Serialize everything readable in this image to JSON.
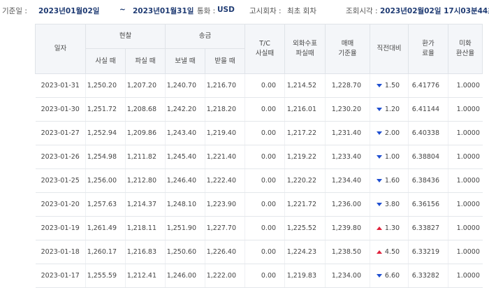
{
  "query": {
    "base_date_label": "기준일 :",
    "start_date": "2023년01월02일",
    "tilde": "~",
    "end_date": "2023년01월31일",
    "currency_label": "통화 :",
    "currency": "USD",
    "notice_label": "고시회차 :",
    "notice_value": "최초 회차",
    "inquiry_label": "조회시각 :",
    "inquiry_time": "2023년02월02일 17시03분44초"
  },
  "table": {
    "headers": {
      "date": "일자",
      "cash": "현찰",
      "cash_buy": "사실 때",
      "cash_sell": "파실 때",
      "remit": "송금",
      "remit_send": "보낼 때",
      "remit_receive": "받을 때",
      "tc_line1": "T/C",
      "tc_line2": "사실때",
      "fx_check_line1": "외화수표",
      "fx_check_line2": "파실때",
      "base_line1": "매매",
      "base_line2": "기준율",
      "change": "직전대비",
      "conv_line1": "환가",
      "conv_line2": "료율",
      "usd_line1": "미화",
      "usd_line2": "환산율"
    },
    "rows": [
      {
        "date": "2023-01-31",
        "cash_buy": "1,250.20",
        "cash_sell": "1,207.20",
        "send": "1,240.70",
        "receive": "1,216.70",
        "tc": "0.00",
        "fx_check": "1,214.52",
        "base": "1,228.70",
        "dir": "down",
        "change": "1.50",
        "conv": "6.41776",
        "usd": "1.0000"
      },
      {
        "date": "2023-01-30",
        "cash_buy": "1,251.72",
        "cash_sell": "1,208.68",
        "send": "1,242.20",
        "receive": "1,218.20",
        "tc": "0.00",
        "fx_check": "1,216.01",
        "base": "1,230.20",
        "dir": "down",
        "change": "1.20",
        "conv": "6.41144",
        "usd": "1.0000"
      },
      {
        "date": "2023-01-27",
        "cash_buy": "1,252.94",
        "cash_sell": "1,209.86",
        "send": "1,243.40",
        "receive": "1,219.40",
        "tc": "0.00",
        "fx_check": "1,217.22",
        "base": "1,231.40",
        "dir": "down",
        "change": "2.00",
        "conv": "6.40338",
        "usd": "1.0000"
      },
      {
        "date": "2023-01-26",
        "cash_buy": "1,254.98",
        "cash_sell": "1,211.82",
        "send": "1,245.40",
        "receive": "1,221.40",
        "tc": "0.00",
        "fx_check": "1,219.22",
        "base": "1,233.40",
        "dir": "down",
        "change": "1.00",
        "conv": "6.38804",
        "usd": "1.0000"
      },
      {
        "date": "2023-01-25",
        "cash_buy": "1,256.00",
        "cash_sell": "1,212.80",
        "send": "1,246.40",
        "receive": "1,222.40",
        "tc": "0.00",
        "fx_check": "1,220.22",
        "base": "1,234.40",
        "dir": "down",
        "change": "1.60",
        "conv": "6.38436",
        "usd": "1.0000"
      },
      {
        "date": "2023-01-20",
        "cash_buy": "1,257.63",
        "cash_sell": "1,214.37",
        "send": "1,248.10",
        "receive": "1,223.90",
        "tc": "0.00",
        "fx_check": "1,221.72",
        "base": "1,236.00",
        "dir": "down",
        "change": "3.80",
        "conv": "6.36156",
        "usd": "1.0000"
      },
      {
        "date": "2023-01-19",
        "cash_buy": "1,261.49",
        "cash_sell": "1,218.11",
        "send": "1,251.90",
        "receive": "1,227.70",
        "tc": "0.00",
        "fx_check": "1,225.52",
        "base": "1,239.80",
        "dir": "up",
        "change": "1.30",
        "conv": "6.33827",
        "usd": "1.0000"
      },
      {
        "date": "2023-01-18",
        "cash_buy": "1,260.17",
        "cash_sell": "1,216.83",
        "send": "1,250.60",
        "receive": "1,226.40",
        "tc": "0.00",
        "fx_check": "1,224.23",
        "base": "1,238.50",
        "dir": "up",
        "change": "4.50",
        "conv": "6.33219",
        "usd": "1.0000"
      },
      {
        "date": "2023-01-17",
        "cash_buy": "1,255.59",
        "cash_sell": "1,212.41",
        "send": "1,246.00",
        "receive": "1,222.00",
        "tc": "0.00",
        "fx_check": "1,219.83",
        "base": "1,234.00",
        "dir": "down",
        "change": "6.60",
        "conv": "6.33282",
        "usd": "1.0000"
      }
    ]
  },
  "colors": {
    "accent_text": "#1f3b73",
    "down_arrow": "#1f4fd1",
    "up_arrow": "#e0213b",
    "header_bg": "#f4f6f9"
  }
}
